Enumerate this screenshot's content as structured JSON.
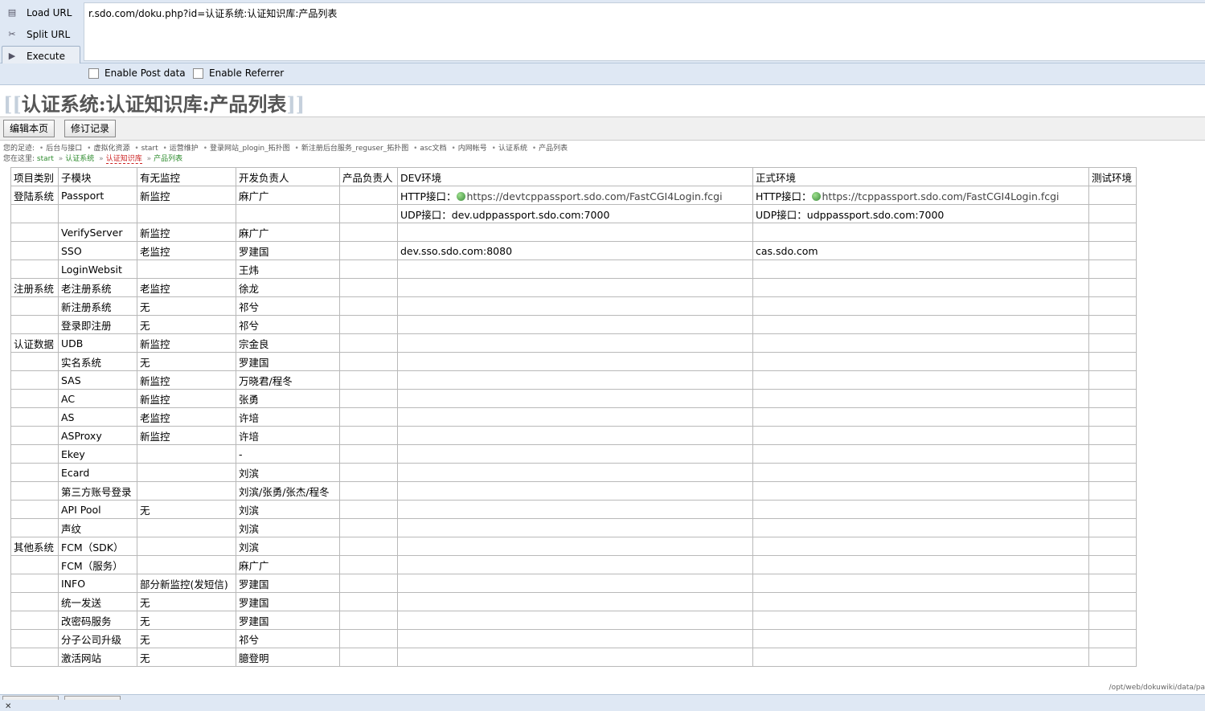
{
  "hackbar": {
    "load_url": "Load URL",
    "split_url": "Split URL",
    "execute": "Execute",
    "url_value": "r.sdo.com/doku.php?id=认证系统:认证知识库:产品列表",
    "enable_post": "Enable Post data",
    "enable_referrer": "Enable Referrer"
  },
  "page": {
    "title": "认证系统:认证知识库:产品列表",
    "bracket_open": "[[",
    "bracket_close": "]]",
    "edit_button": "编辑本页",
    "revisions_button": "修订记录",
    "trace_label": "您的足迹:",
    "trace": [
      "后台与接口",
      "虚拟化资源",
      "start",
      "运营维护",
      "登录网站_plogin_拓扑图",
      "新注册后台服务_reguser_拓扑图",
      "asc文档",
      "内网帐号",
      "认证系统",
      "产品列表"
    ],
    "youhere_label": "您在这里:",
    "youhere": [
      "start",
      "认证系统",
      "认证知识库",
      "产品列表"
    ],
    "footer_path": "/opt/web/dokuwiki/data/pa"
  },
  "table": {
    "headers": [
      "项目类别",
      "子模块",
      "有无监控",
      "开发负责人",
      "产品负责人",
      "DEV环境",
      "正式环境",
      "测试环境"
    ],
    "rows": [
      [
        "登陆系统",
        "Passport",
        "新监控",
        "麻广广",
        "",
        "HTTP接口：",
        "HTTP接口：",
        ""
      ],
      [
        "",
        "",
        "",
        "",
        "",
        "UDP接口：dev.udppassport.sdo.com:7000",
        "UDP接口：udppassport.sdo.com:7000",
        ""
      ],
      [
        "",
        "VerifyServer",
        "新监控",
        "麻广广",
        "",
        "",
        "",
        ""
      ],
      [
        "",
        "SSO",
        "老监控",
        "罗建国",
        "",
        "dev.sso.sdo.com:8080",
        "cas.sdo.com",
        ""
      ],
      [
        "",
        "LoginWebsit",
        "",
        "王炜",
        "",
        "",
        "",
        ""
      ],
      [
        "注册系统",
        "老注册系统",
        "老监控",
        "徐龙",
        "",
        "",
        "",
        ""
      ],
      [
        "",
        "新注册系统",
        "无",
        "祁兮",
        "",
        "",
        "",
        ""
      ],
      [
        "",
        "登录即注册",
        "无",
        "祁兮",
        "",
        "",
        "",
        ""
      ],
      [
        "认证数据",
        "UDB",
        "新监控",
        "宗金良",
        "",
        "",
        "",
        ""
      ],
      [
        "",
        "实名系统",
        "无",
        "罗建国",
        "",
        "",
        "",
        ""
      ],
      [
        "",
        "SAS",
        "新监控",
        "万晓君/程冬",
        "",
        "",
        "",
        ""
      ],
      [
        "",
        "AC",
        "新监控",
        "张勇",
        "",
        "",
        "",
        ""
      ],
      [
        "",
        "AS",
        "老监控",
        "许培",
        "",
        "",
        "",
        ""
      ],
      [
        "",
        "ASProxy",
        "新监控",
        "许培",
        "",
        "",
        "",
        ""
      ],
      [
        "",
        "Ekey",
        "",
        "-",
        "",
        "",
        "",
        ""
      ],
      [
        "",
        "Ecard",
        "",
        "刘滨",
        "",
        "",
        "",
        ""
      ],
      [
        "",
        "第三方账号登录",
        "",
        "刘滨/张勇/张杰/程冬",
        "",
        "",
        "",
        ""
      ],
      [
        "",
        "API Pool",
        "无",
        "刘滨",
        "",
        "",
        "",
        ""
      ],
      [
        "",
        "声纹",
        "",
        "刘滨",
        "",
        "",
        "",
        ""
      ],
      [
        "其他系统",
        "FCM（SDK）",
        "",
        "刘滨",
        "",
        "",
        "",
        ""
      ],
      [
        "",
        "FCM（服务）",
        "",
        "麻广广",
        "",
        "",
        "",
        ""
      ],
      [
        "",
        "INFO",
        "部分新监控(发短信)",
        "罗建国",
        "",
        "",
        "",
        ""
      ],
      [
        "",
        "统一发送",
        "无",
        "罗建国",
        "",
        "",
        "",
        ""
      ],
      [
        "",
        "改密码服务",
        "无",
        "罗建国",
        "",
        "",
        "",
        ""
      ],
      [
        "",
        "分子公司升级",
        "无",
        "祁兮",
        "",
        "",
        "",
        ""
      ],
      [
        "",
        "激活网站",
        "无",
        "臆登明",
        "",
        "",
        "",
        ""
      ]
    ],
    "links": {
      "dev_http": "https://devtcppassport.sdo.com/FastCGI4Login.fcgi",
      "prod_http": "https://tcppassport.sdo.com/FastCGI4Login.fcgi"
    }
  }
}
